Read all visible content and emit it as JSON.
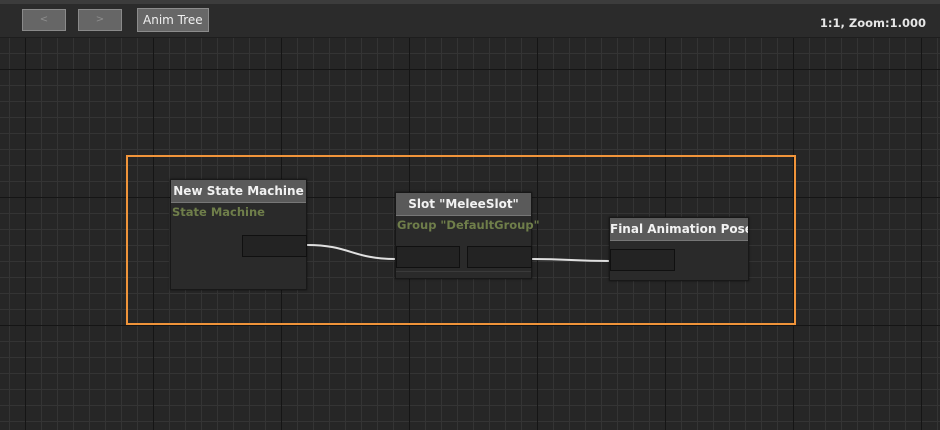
{
  "toolbar": {
    "back_label": "<",
    "forward_label": ">",
    "breadcrumb_label": "Anim Tree",
    "zoom_text": "1:1, Zoom:1.000"
  },
  "graph": {
    "nodes": {
      "state_machine": {
        "title": "New State Machine",
        "subtitle": "State Machine"
      },
      "slot": {
        "title": "Slot \"MeleeSlot\"",
        "subtitle": "Group \"DefaultGroup\""
      },
      "final_pose": {
        "title": "Final Animation Pose"
      }
    }
  },
  "colors": {
    "selection": "#f0943a",
    "wire": "#e0e0e0",
    "subtitle": "#6f7e4a",
    "node_header": "#5a5a5a",
    "canvas": "#262626"
  }
}
